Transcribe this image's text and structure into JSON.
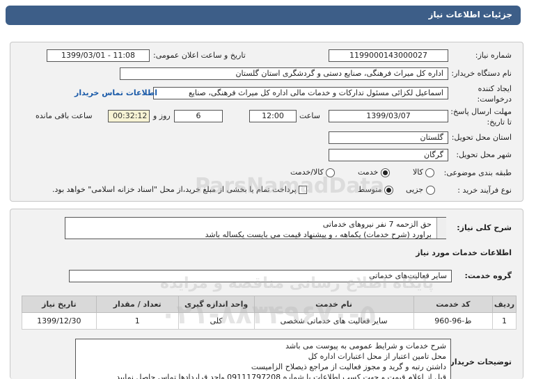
{
  "header": {
    "title": "جزئیات اطلاعات نیاز"
  },
  "fields": {
    "need_number_label": "شماره نیاز:",
    "need_number": "1199000143000027",
    "announce_label": "تاریخ و ساعت اعلان عمومی:",
    "announce_value": "1399/03/01 - 11:08",
    "buyer_label": "نام دستگاه خریدار:",
    "buyer_value": "اداره کل میراث فرهنگی، صنایع دستی و گردشگری استان گلستان",
    "creator_label_1": "ایجاد کننده",
    "creator_label_2": "درخواست:",
    "creator_value": "اسماعیل لکزائی مسئول تدارکات و خدمات مالی اداره کل میراث فرهنگی، صنایع",
    "contact_link": "اطلاعات تماس خریدار",
    "deadline_label_1": "مهلت ارسال پاسخ:",
    "deadline_label_2": "تا تاریخ:",
    "deadline_date": "1399/03/07",
    "hour_label": "ساعت",
    "deadline_time": "12:00",
    "days_value": "6",
    "days_label": "روز و",
    "remaining_time": "00:32:12",
    "remaining_label": "ساعت باقی مانده",
    "province_label": "استان محل تحویل:",
    "province_value": "گلستان",
    "city_label": "شهر محل تحویل:",
    "city_value": "گرگان",
    "category_label": "طبقه بندی موضوعی:",
    "category_options": [
      "کالا",
      "خدمت",
      "کالا/خدمت"
    ],
    "category_selected": "خدمت",
    "process_label": "نوع فرآیند خرید :",
    "process_options": [
      "جزیی",
      "متوسط"
    ],
    "process_selected": "متوسط",
    "payment_note": "پرداخت تمام یا بخشی از مبلغ خرید،از محل \"اسناد خزانه اسلامی\" خواهد بود."
  },
  "summary": {
    "label": "شرح کلی نیاز:",
    "line1": "حق الزحمه 7 نفر نیروهای خدماتی",
    "line2": "براورد (شرح خدمات) یکماهه ، و پیشنهاد قیمت می بایست یکساله باشد"
  },
  "services": {
    "section_title": "اطلاعات خدمات مورد نیاز",
    "group_label": "گروه خدمت:",
    "group_value": "سایر فعالیت‌های خدماتی",
    "columns": [
      "ردیف",
      "کد خدمت",
      "نام خدمت",
      "واحد اندازه گیری",
      "تعداد / مقدار",
      "تاریخ نیاز"
    ],
    "rows": [
      [
        "1",
        "ط-96-960",
        "سایر فعالیت های خدماتی شخصی",
        "کلی",
        "1",
        "1399/12/30"
      ]
    ]
  },
  "buyer_notes": {
    "label": "توضیحات خریدار:",
    "lines": [
      "شرح خدمات و شرایط عمومی به پیوست می باشد",
      "محل تامین اعتبار از محل اعتبارات اداره کل",
      "داشتن رتبه و گرید و مجوز فعالیت از مراجع ذیصلاح الزامیست",
      "قبل از اعلام قیمت و جهت کسب اطلاعات با شماره 09111797208 واحد قراردادها تماس حاصل نمایید"
    ]
  },
  "watermark": {
    "brand": "ParsNamadData",
    "tagline": "پایگاه اطلاع رسانی مناقصه و مزایده",
    "phone": "۰۲۱-۸۸۳۴۹۶۷۰-۵"
  }
}
